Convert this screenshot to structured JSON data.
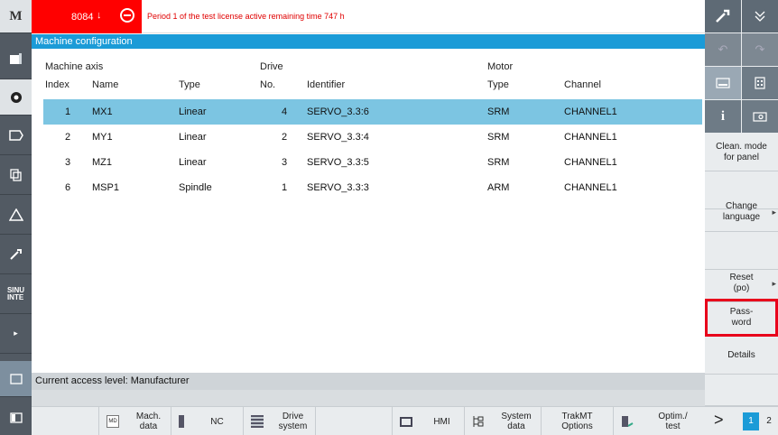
{
  "alarm": {
    "number": "8084",
    "arrow": "↓",
    "message": "Period 1 of the test license active remaining time 747 h"
  },
  "header_title": "Machine configuration",
  "table": {
    "group_headers": {
      "axis": "Machine axis",
      "drive": "Drive",
      "motor": "Motor"
    },
    "columns": {
      "index": "Index",
      "name": "Name",
      "type": "Type",
      "no": "No.",
      "identifier": "Identifier",
      "motor_type": "Type",
      "channel": "Channel"
    },
    "rows": [
      {
        "index": "1",
        "name": "MX1",
        "type": "Linear",
        "no": "4",
        "identifier": "SERVO_3.3:6",
        "motor": "SRM",
        "channel": "CHANNEL1"
      },
      {
        "index": "2",
        "name": "MY1",
        "type": "Linear",
        "no": "2",
        "identifier": "SERVO_3.3:4",
        "motor": "SRM",
        "channel": "CHANNEL1"
      },
      {
        "index": "3",
        "name": "MZ1",
        "type": "Linear",
        "no": "3",
        "identifier": "SERVO_3.3:5",
        "motor": "SRM",
        "channel": "CHANNEL1"
      },
      {
        "index": "6",
        "name": "MSP1",
        "type": "Spindle",
        "no": "1",
        "identifier": "SERVO_3.3:3",
        "motor": "ARM",
        "channel": "CHANNEL1"
      }
    ]
  },
  "status": "Current access level: Manufacturer",
  "left_bar": {
    "logo": "M",
    "sinu": "SINU\nINTE"
  },
  "bottom_softkeys": [
    {
      "label": "Mach.\ndata",
      "icon": "md-icon",
      "icon_text": "MD"
    },
    {
      "label": "NC",
      "icon": "nc-icon"
    },
    {
      "label": "Drive\nsystem",
      "icon": "drive-icon"
    },
    {
      "label": "HMI",
      "icon": "hmi-icon"
    },
    {
      "label": "System\ndata",
      "icon": "system-data-icon"
    },
    {
      "label": "TrakMT\nOptions",
      "icon": ""
    },
    {
      "label": "Optim./\ntest",
      "icon": "optim-icon"
    }
  ],
  "bottom_right": {
    "next": ">",
    "page1": "1",
    "page2": "2"
  },
  "right_softkeys": [
    {
      "label": ""
    },
    {
      "label": "Clean. mode\nfor panel"
    },
    {
      "label": ""
    },
    {
      "label": "Change\nlanguage"
    },
    {
      "label": ""
    },
    {
      "label": "Reset\n(po)"
    },
    {
      "label": "Pass-\nword"
    },
    {
      "label": "Details"
    }
  ],
  "colors": {
    "alarm_red": "#ff0000",
    "header_blue": "#1b9bd7",
    "selection": "#7cc5e2",
    "highlight": "#e8001b"
  }
}
